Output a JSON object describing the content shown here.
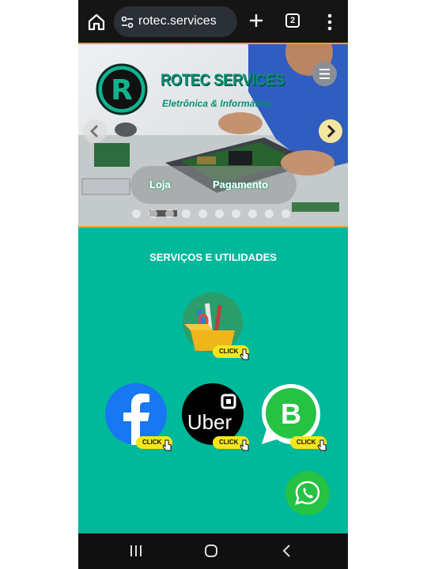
{
  "browser": {
    "url": "rotec.services",
    "tab_count": "2",
    "icons": [
      "home-icon",
      "site-settings-icon",
      "plus-icon",
      "tabs-icon",
      "more-vert-icon"
    ]
  },
  "banner": {
    "brand_name": "ROTEC SERVICES",
    "brand_sub": "Eletrônica & Informática",
    "logo_letter": "R",
    "link_loja": "Loja",
    "link_pagamento": "Pagamento",
    "slide_count": 10
  },
  "section": {
    "title": "SERVIÇOS E UTILIDADES",
    "click_label": "CLICK",
    "services": [
      {
        "name": "tools",
        "icon": "tools-box-icon"
      },
      {
        "name": "facebook",
        "icon": "facebook-icon"
      },
      {
        "name": "uber",
        "icon": "uber-icon",
        "label": "Uber"
      },
      {
        "name": "whatsapp-business",
        "icon": "whatsapp-business-icon",
        "label": "B"
      }
    ]
  },
  "colors": {
    "accent": "#00b89a",
    "gold": "#e0a82a",
    "click_yellow": "#f5e61c",
    "whatsapp": "#25c244"
  }
}
